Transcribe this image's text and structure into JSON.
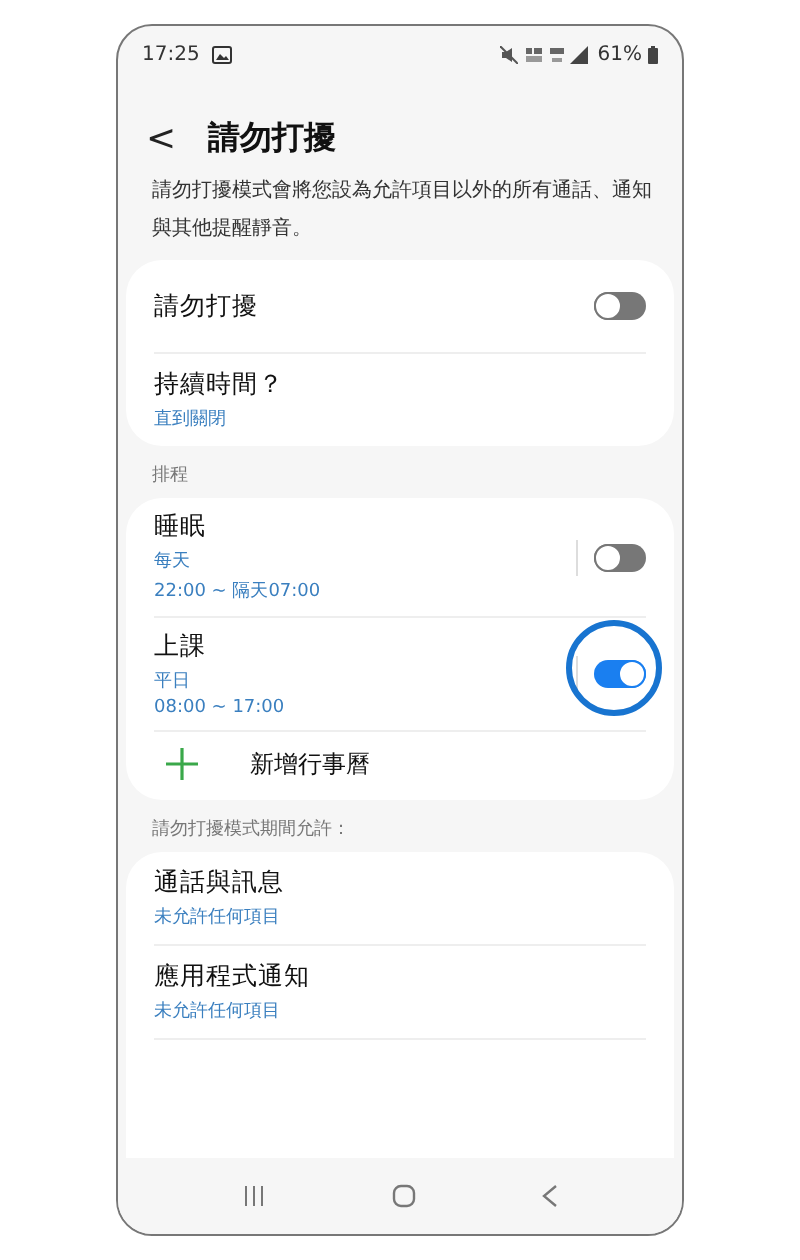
{
  "status_bar": {
    "time": "17:25",
    "battery": "61%"
  },
  "header": {
    "back": "<",
    "title": "請勿打擾"
  },
  "description": "請勿打擾模式會將您設為允許項目以外的所有通話、通知與其他提醒靜音。",
  "main_card": [
    {
      "kind": "toggle",
      "title": "請勿打擾",
      "on": false
    },
    {
      "kind": "link",
      "title": "持續時間？",
      "subtitle": "直到關閉"
    }
  ],
  "schedule": {
    "label": "排程",
    "items": [
      {
        "title": "睡眠",
        "days": "每天",
        "time": "22:00 ~ 隔天07:00",
        "on": false,
        "highlighted": false
      },
      {
        "title": "上課",
        "days": "平日",
        "time": "08:00 ~ 17:00",
        "on": true,
        "highlighted": true
      }
    ],
    "add_label": "新增行事曆"
  },
  "allowed": {
    "label": "請勿打擾模式期間允許：",
    "items": [
      {
        "title": "通話與訊息",
        "subtitle": "未允許任何項目"
      },
      {
        "title": "應用程式通知",
        "subtitle": "未允許任何項目"
      }
    ]
  }
}
